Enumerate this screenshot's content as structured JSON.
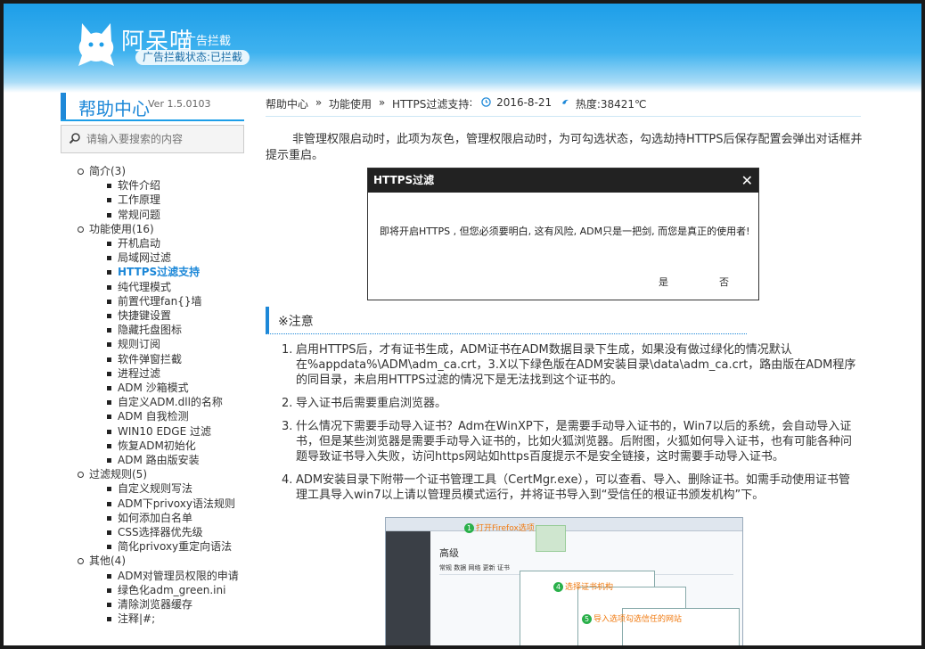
{
  "header": {
    "title": "阿呆喵",
    "subtitle": "广告拦截",
    "status": "广告拦截状态:已拦截"
  },
  "sidebar": {
    "help_title": "帮助中心",
    "version": "Ver 1.5.0103",
    "search_placeholder": "请输入要搜索的内容",
    "groups": [
      {
        "label": "简介(3)",
        "items": [
          "软件介绍",
          "工作原理",
          "常规问题"
        ]
      },
      {
        "label": "功能使用(16)",
        "items": [
          "开机启动",
          "局域网过滤",
          "HTTPS过滤支持",
          "纯代理模式",
          "前置代理fan{}墙",
          "快捷键设置",
          "隐藏托盘图标",
          "规则订阅",
          "软件弹窗拦截",
          "进程过滤",
          "ADM 沙箱模式",
          "自定义ADM.dll的名称",
          "ADM 自我检测",
          "WIN10 EDGE 过滤",
          "恢复ADM初始化",
          "ADM 路由版安装"
        ]
      },
      {
        "label": "过滤规则(5)",
        "items": [
          "自定义规则写法",
          "ADM下privoxy语法规则",
          "如何添加白名单",
          "CSS选择器优先级",
          "简化privoxy重定向语法"
        ]
      },
      {
        "label": "其他(4)",
        "items": [
          "ADM对管理员权限的申请",
          "绿色化adm_green.ini",
          "清除浏览器缓存",
          "注释|#;"
        ]
      }
    ],
    "active_item": "HTTPS过滤支持"
  },
  "breadcrumb": {
    "home": "帮助中心",
    "sep": "»",
    "section": "功能使用",
    "page": "HTTPS过滤支持",
    "colon": ":",
    "date": "2016-8-21",
    "heat": "热度:38421℃"
  },
  "content": {
    "intro": "非管理权限启动时，此项为灰色，管理权限启动时，为可勾选状态，勾选劫持HTTPS后保存配置会弹出对话框并提示重启。",
    "dialog": {
      "title": "HTTPS过滤",
      "close": "✕",
      "message": "即将开启HTTPS , 但您必须要明白, 这有风险, ADM只是一把剑, 而您是真正的使用者!",
      "yes": "是",
      "no": "否"
    },
    "note_title": "※注意",
    "notes": [
      "启用HTTPS后，才有证书生成，ADM证书在ADM数据目录下生成，如果没有做过绿化的情况默认在%appdata%\\ADM\\adm_ca.crt，3.X以下绿色版在ADM安装目录\\data\\adm_ca.crt，路由版在ADM程序的同目录，未启用HTTPS过滤的情况下是无法找到这个证书的。",
      "导入证书后需要重启浏览器。",
      "什么情况下需要手动导入证书？Adm在WinXP下，是需要手动导入证书的，Win7以后的系统，会自动导入证书，但是某些浏览器是需要手动导入证书的，比如火狐浏览器。后附图，火狐如何导入证书，也有可能各种问题导致证书导入失败，访问https网站如https百度提示不是安全链接，这时需要手动导入证书。",
      "ADM安装目录下附带一个证书管理工具（CertMgr.exe），可以查看、导入、删除证书。如需手动使用证书管理工具导入win7以上请以管理员模式运行，并将证书导入到“受信任的根证书颁发机构”下。"
    ],
    "note_numbers": [
      "1.",
      "2.",
      "3.",
      "4."
    ],
    "screenshot": {
      "pane_title": "高级",
      "tabs": "常规   数据   网络   更新   证书",
      "step1": "打开Firefox选项",
      "step4": "选择证书机构",
      "step5": "导入选项勾选信任的网站",
      "step_nums": [
        "1",
        "4",
        "5"
      ],
      "settings_label": "选项"
    }
  },
  "colors": {
    "accent": "#1d88d8",
    "header_blue": "#1d9ee8",
    "dialog_bar": "#222222"
  }
}
